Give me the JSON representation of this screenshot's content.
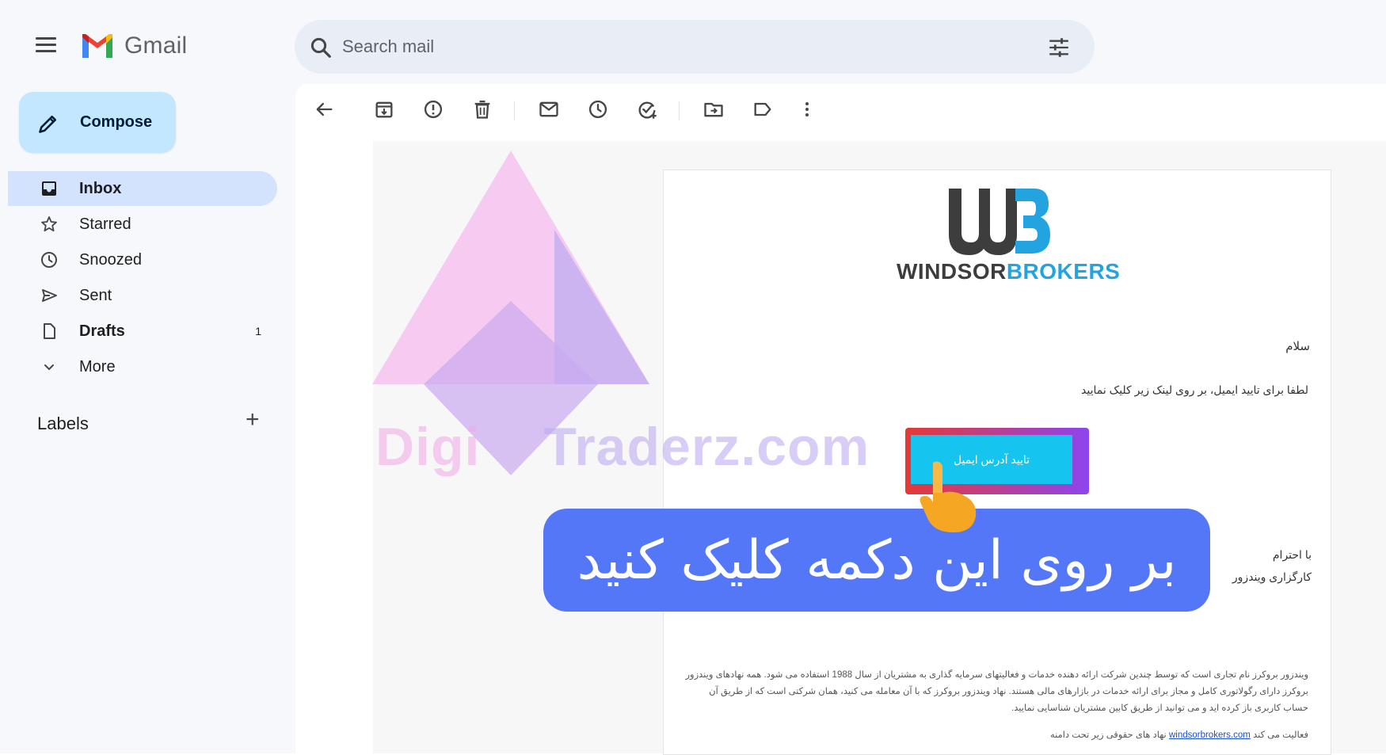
{
  "app": {
    "name": "Gmail"
  },
  "search": {
    "placeholder": "Search mail"
  },
  "compose": {
    "label": "Compose"
  },
  "nav": {
    "items": [
      {
        "label": "Inbox",
        "icon": "inbox-icon",
        "active": true
      },
      {
        "label": "Starred",
        "icon": "star-icon"
      },
      {
        "label": "Snoozed",
        "icon": "clock-icon"
      },
      {
        "label": "Sent",
        "icon": "send-icon"
      },
      {
        "label": "Drafts",
        "icon": "draft-icon",
        "count": "1"
      },
      {
        "label": "More",
        "icon": "chevron-down-icon"
      }
    ]
  },
  "labels": {
    "title": "Labels"
  },
  "toolbar": {
    "icons": [
      "back-arrow-icon",
      "archive-icon",
      "report-spam-icon",
      "delete-icon",
      "mark-unread-icon",
      "snooze-icon",
      "add-task-icon",
      "move-to-icon",
      "label-icon",
      "more-vert-icon"
    ]
  },
  "email": {
    "brand_part1": "WINDSOR",
    "brand_part2": "BROKERS",
    "greeting": "سلام",
    "instruction": "لطفا برای تایید ایمیل، بر روی لینک زیر کلیک نمایید",
    "verify_button": "تایید آدرس ایمیل",
    "closing_1": "با احترام",
    "closing_2": "کارگزاری ویندزور",
    "footer_paragraph": "ویندزور بروکرز نام تجاری است که توسط چندین شرکت ارائه دهنده خدمات و فعالیتهای سرمایه گذاری به مشتریان از سال 1988 استفاده می شود. همه نهادهای ویندزور بروکرز دارای رگولاتوری کامل و مجاز برای ارائه خدمات در بازارهای مالی هستند. نهاد ویندزور بروکرز که با آن معامله می کنید، همان شرکتی است که از طریق آن حساب کاربری باز کرده اید و می توانید از طریق کابین مشتریان شناسایی نمایید.",
    "footer_prefix": "فعالیت می کند",
    "footer_link": "windsorbrokers.com",
    "footer_suffix": "نهاد های حقوقی زیر تحت دامنه"
  },
  "watermark": {
    "part1": "Digi",
    "part2": "Traderz.com"
  },
  "overlay": {
    "caption": "بر روی این دکمه کلیک کنید"
  },
  "colors": {
    "compose_bg": "#c2e7ff",
    "active_nav": "#d3e3fd",
    "search_bg": "#e9eef6",
    "verify_button": "#16c4f0",
    "caption_bg": "#5477f7"
  }
}
